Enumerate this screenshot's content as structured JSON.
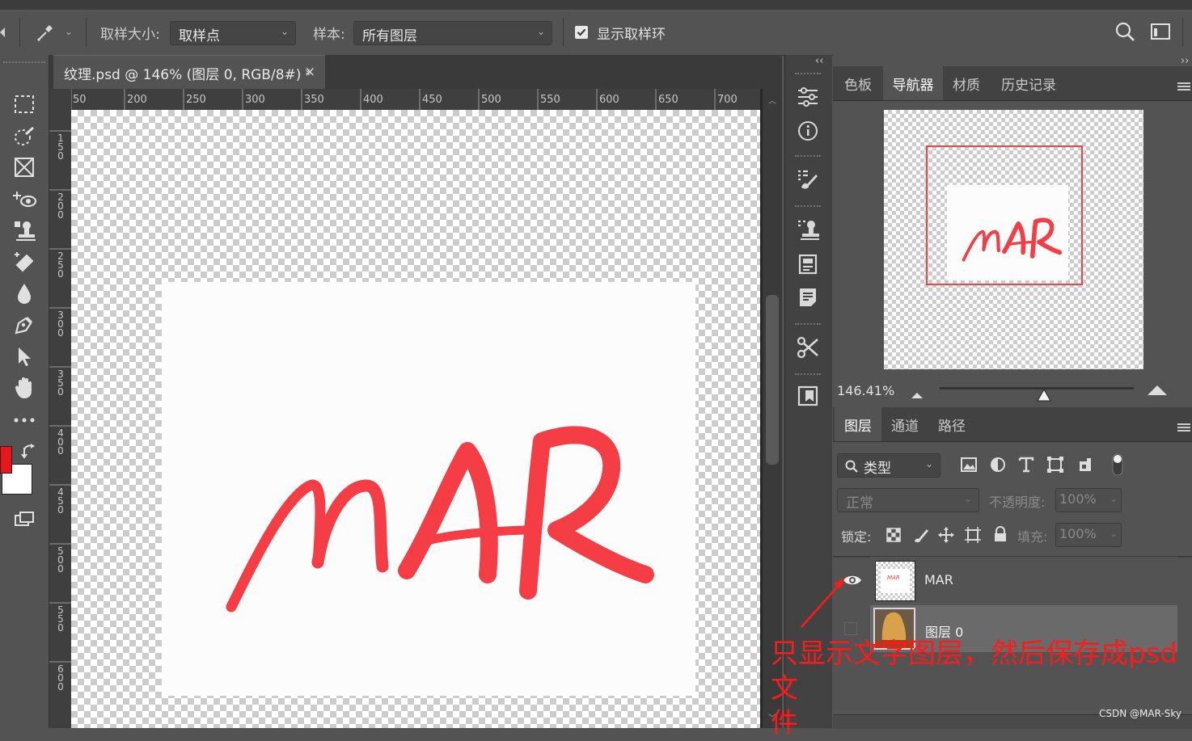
{
  "options_bar": {
    "sample_size_label": "取样大小:",
    "sample_size_value": "取样点",
    "sample_label": "样本:",
    "sample_value": "所有图层",
    "show_ring_label": "显示取样环",
    "show_ring_checked": true
  },
  "document": {
    "tab_title": "纹理.psd @ 146% (图层 0, RGB/8#) *",
    "close_glyph": "×",
    "h_ruler": [
      "50",
      "200",
      "250",
      "300",
      "350",
      "400",
      "450",
      "500",
      "550",
      "600",
      "650",
      "700"
    ],
    "v_ruler": [
      "150",
      "200",
      "250",
      "300",
      "350",
      "400",
      "450",
      "500",
      "550",
      "600"
    ],
    "canvas_text": "MAR"
  },
  "colors": {
    "foreground": "#e8161a",
    "background": "#ffffff",
    "text_red": "#f43d45",
    "annotation_red": "#ff1a1a"
  },
  "panels_top": {
    "tabs": [
      "色板",
      "导航器",
      "材质",
      "历史记录"
    ],
    "active_tab": "导航器",
    "zoom": "146.41%",
    "collapse_glyph": "››"
  },
  "layers_panel": {
    "tabs": [
      "图层",
      "通道",
      "路径"
    ],
    "active_tab": "图层",
    "filter_label": "类型",
    "blend_mode": "正常",
    "opacity_label": "不透明度:",
    "opacity_value": "100%",
    "lock_label": "锁定:",
    "fill_label": "填充:",
    "fill_value": "100%",
    "layers": [
      {
        "name": "MAR",
        "visible": true,
        "thumb_text": "MAR"
      },
      {
        "name": "图层 0",
        "visible": false
      }
    ]
  },
  "annotation": {
    "line1": "只显示文字图层，然后保存成psd文",
    "line2": "件"
  },
  "watermark": "CSDN @MAR-Sky",
  "icons": [
    "home-icon",
    "eyedropper-icon",
    "search-icon",
    "workspace-icon",
    "marquee-icon",
    "quick-select-icon",
    "frame-icon",
    "spot-heal-icon",
    "stamp-icon",
    "eraser-icon",
    "blur-icon",
    "pen-icon",
    "path-select-icon",
    "hand-icon",
    "more-icon",
    "swap-icon",
    "screen-mode-icon",
    "adjustments-icon",
    "info-icon",
    "brush-presets-icon",
    "clone-source-icon",
    "glyphs-icon",
    "notes-icon",
    "tool-presets-icon",
    "artboard-icon",
    "eye-icon",
    "lock-icon"
  ]
}
